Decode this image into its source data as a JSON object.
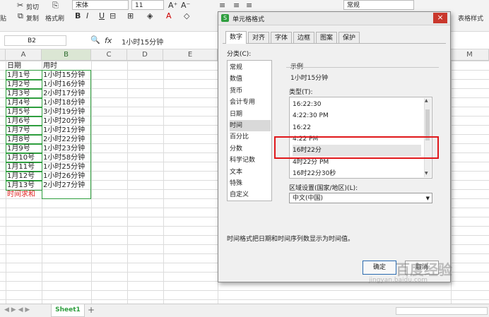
{
  "ribbon": {
    "cut": "剪切",
    "copy": "复制",
    "format_painter": "格式刷",
    "paste_partial": "贴",
    "font_name": "宋体",
    "font_size": "11",
    "number_format": "常规",
    "table_style": "表格样式"
  },
  "formula_bar": {
    "cell_ref": "B2",
    "fx_label": "fx",
    "value": "1小时15分钟"
  },
  "columns": [
    "A",
    "B",
    "C",
    "D",
    "E",
    "M"
  ],
  "rows": [
    {
      "a": "日期",
      "b": "用时"
    },
    {
      "a": "1月1号",
      "b": "1小时15分钟"
    },
    {
      "a": "1月2号",
      "b": "1小时16分钟"
    },
    {
      "a": "1月3号",
      "b": "2小时17分钟"
    },
    {
      "a": "1月4号",
      "b": "1小时18分钟"
    },
    {
      "a": "1月5号",
      "b": "3小时19分钟"
    },
    {
      "a": "1月6号",
      "b": "1小时20分钟"
    },
    {
      "a": "1月7号",
      "b": "1小时21分钟"
    },
    {
      "a": "1月8号",
      "b": "2小时22分钟"
    },
    {
      "a": "1月9号",
      "b": "1小时23分钟"
    },
    {
      "a": "1月10号",
      "b": "1小时58分钟"
    },
    {
      "a": "1月11号",
      "b": "1小时25分钟"
    },
    {
      "a": "1月12号",
      "b": "1小时26分钟"
    },
    {
      "a": "1月13号",
      "b": "2小时27分钟"
    },
    {
      "a": "时间求和",
      "b": ""
    }
  ],
  "sheet_tab": "Sheet1",
  "dialog": {
    "title": "单元格格式",
    "tabs": [
      "数字",
      "对齐",
      "字体",
      "边框",
      "图案",
      "保护"
    ],
    "category_label": "分类(C):",
    "categories": [
      "常规",
      "数值",
      "货币",
      "会计专用",
      "日期",
      "时间",
      "百分比",
      "分数",
      "科学记数",
      "文本",
      "特殊",
      "自定义"
    ],
    "selected_category": "时间",
    "sample_label": "示例",
    "sample_value": "1小时15分钟",
    "type_label": "类型(T):",
    "types": [
      "16:22:30",
      "4:22:30 PM",
      "16:22",
      "4:22 PM",
      "16时22分",
      "4时22分 PM",
      "16时22分30秒"
    ],
    "selected_type": "16时22分",
    "locale_label": "区域设置(国家/地区)(L):",
    "locale_value": "中文(中国)",
    "description": "时间格式把日期和时间序列数显示为时间值。",
    "ok": "确定",
    "cancel": "取消",
    "close": "×"
  },
  "watermark": {
    "text": "百度经验",
    "url": "jingyan.baidu.com"
  },
  "colors": {
    "accent_green": "#2e9e3e",
    "highlight_red": "#e0181b",
    "sum_label_red": "#e02020"
  }
}
